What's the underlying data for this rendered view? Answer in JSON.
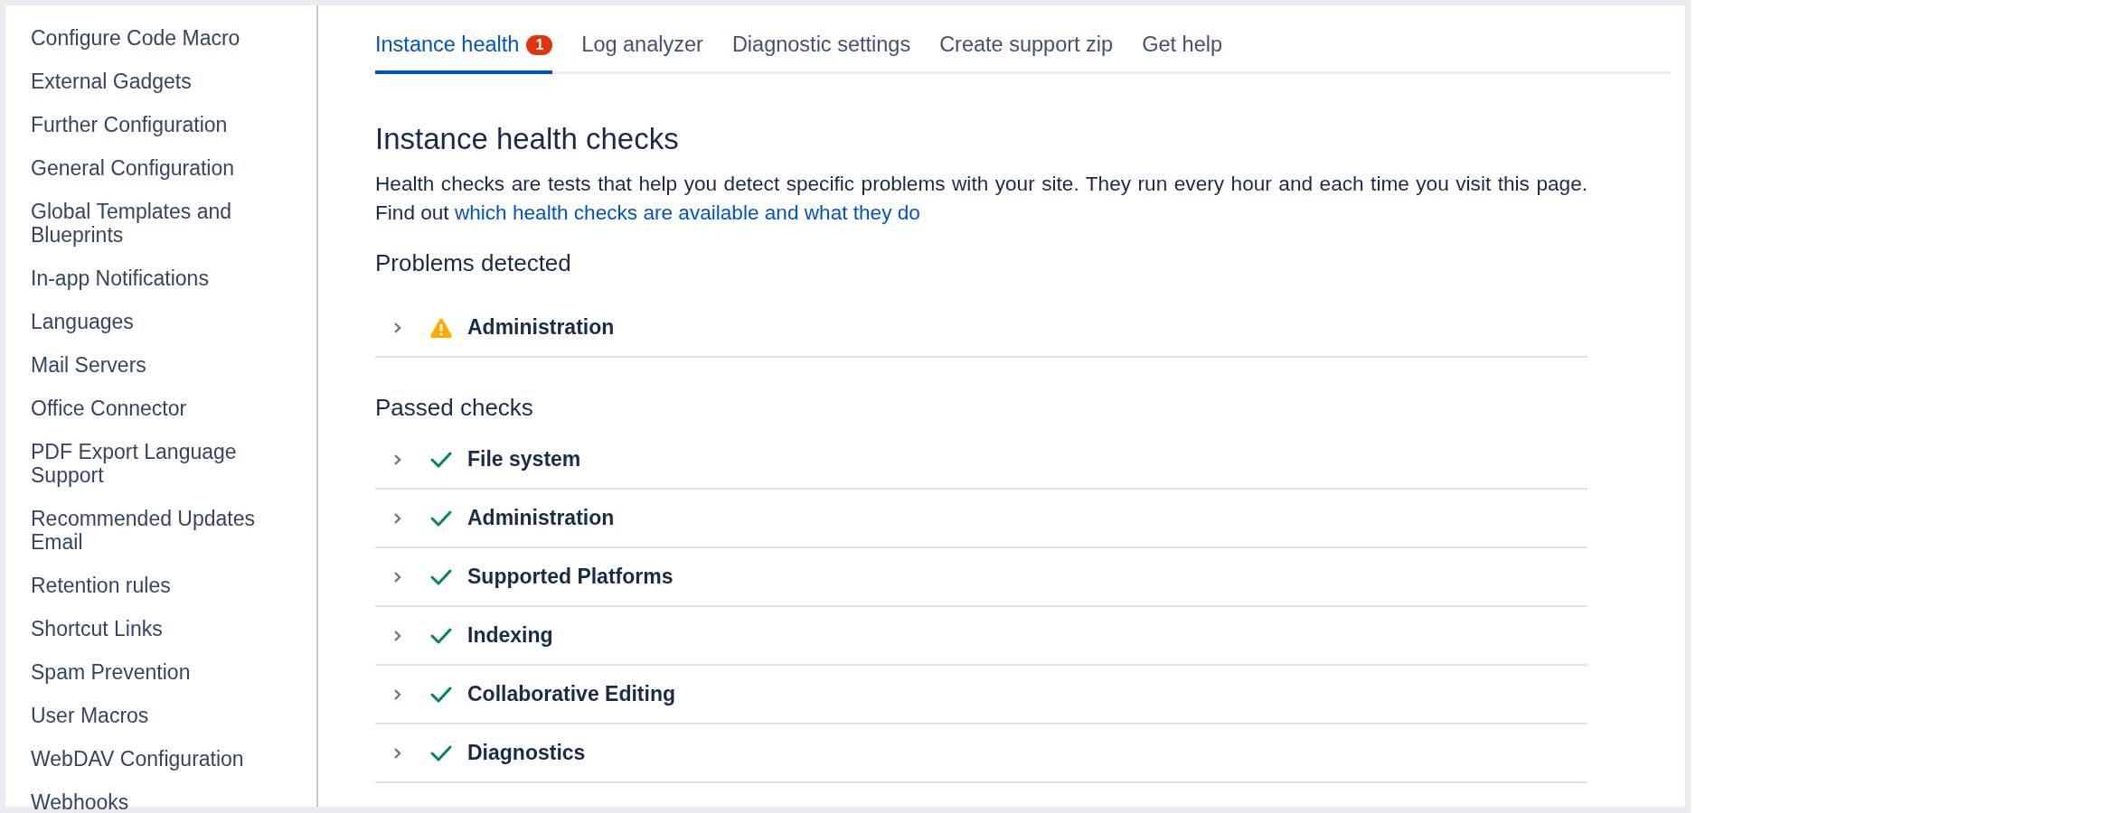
{
  "sidebar": {
    "items": [
      {
        "label": "Configure Code Macro"
      },
      {
        "label": "External Gadgets"
      },
      {
        "label": "Further Configuration"
      },
      {
        "label": "General Configuration"
      },
      {
        "label": "Global Templates and Blueprints"
      },
      {
        "label": "In-app Notifications"
      },
      {
        "label": "Languages"
      },
      {
        "label": "Mail Servers"
      },
      {
        "label": "Office Connector"
      },
      {
        "label": "PDF Export Language Support"
      },
      {
        "label": "Recommended Updates Email"
      },
      {
        "label": "Retention rules"
      },
      {
        "label": "Shortcut Links"
      },
      {
        "label": "Spam Prevention"
      },
      {
        "label": "User Macros"
      },
      {
        "label": "WebDAV Configuration"
      },
      {
        "label": "Webhooks"
      }
    ]
  },
  "tabs": [
    {
      "label": "Instance health",
      "selected": true,
      "badge": "1"
    },
    {
      "label": "Log analyzer",
      "selected": false
    },
    {
      "label": "Diagnostic settings",
      "selected": false
    },
    {
      "label": "Create support zip",
      "selected": false
    },
    {
      "label": "Get help",
      "selected": false
    }
  ],
  "title": "Instance health checks",
  "intro": {
    "text": "Health checks are tests that help you detect specific problems with your site. They run every hour and each time you visit this page. Find out",
    "link": "which health checks are available and what they do"
  },
  "sections": [
    {
      "heading": "Problems detected",
      "checks": [
        {
          "name": "Administration",
          "kind": "warning",
          "expanded": false
        }
      ]
    },
    {
      "heading": "Passed checks",
      "checks": [
        {
          "name": "File system",
          "kind": "passed",
          "expanded": false
        },
        {
          "name": "Administration",
          "kind": "passed",
          "expanded": false
        },
        {
          "name": "Supported Platforms",
          "kind": "passed",
          "expanded": false
        },
        {
          "name": "Indexing",
          "kind": "passed",
          "expanded": false
        },
        {
          "name": "Collaborative Editing",
          "kind": "passed",
          "expanded": false
        },
        {
          "name": "Diagnostics",
          "kind": "passed",
          "expanded": false
        }
      ]
    }
  ]
}
